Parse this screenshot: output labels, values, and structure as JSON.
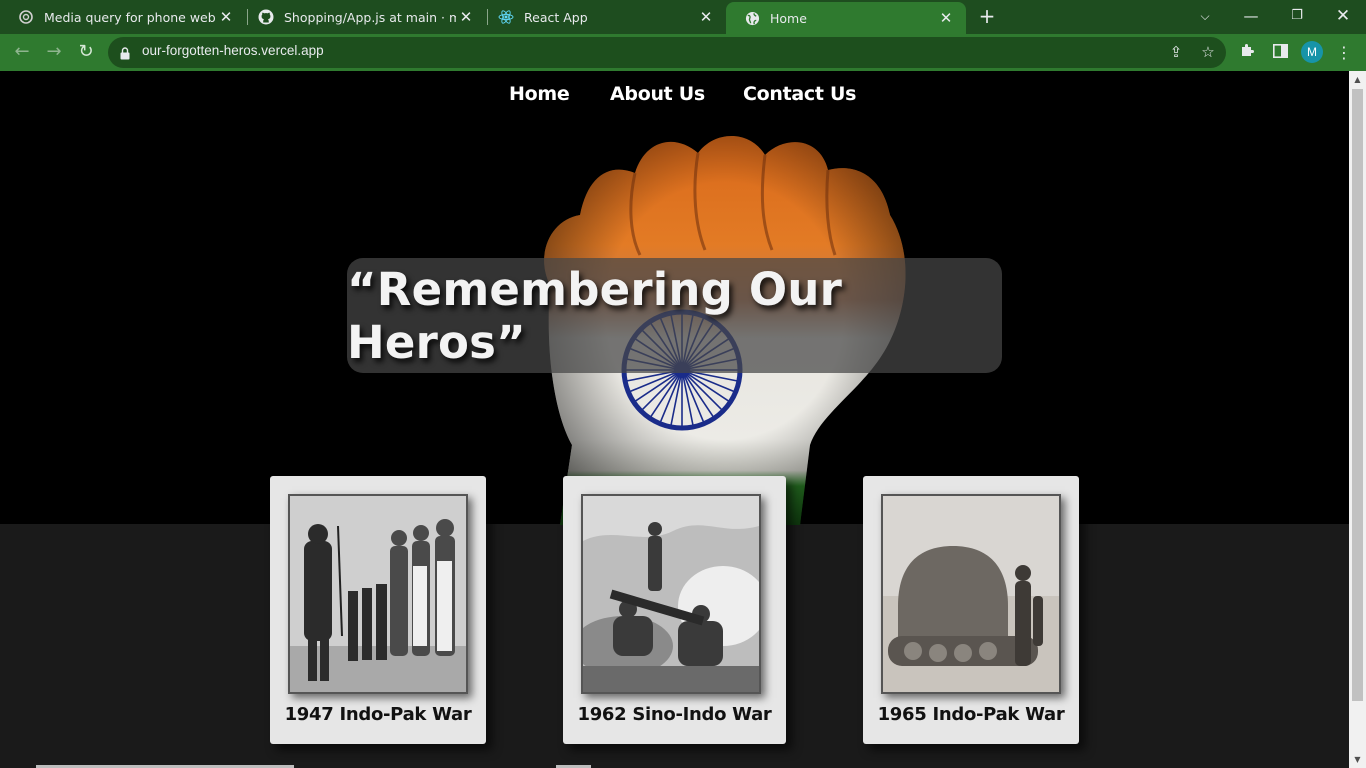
{
  "browser": {
    "tabs": [
      {
        "title": "Media query for phone website.",
        "icon": "chatgpt-icon",
        "active": false
      },
      {
        "title": "Shopping/App.js at main · mkgupta",
        "icon": "github-icon",
        "active": false
      },
      {
        "title": "React App",
        "icon": "react-icon",
        "active": false
      },
      {
        "title": "Home",
        "icon": "globe-icon",
        "active": true
      }
    ],
    "url": "our-forgotten-heros.vercel.app",
    "profile_initial": "M",
    "colors": {
      "frame": "#1e4d1f",
      "toolbar": "#2f7a2f",
      "avatar": "#1794a8"
    }
  },
  "page": {
    "nav": {
      "home": "Home",
      "about": "About Us",
      "contact": "Contact Us"
    },
    "hero": {
      "quote": "“Remembering Our Heros”"
    },
    "cards": [
      {
        "title": "1947 Indo-Pak War"
      },
      {
        "title": "1962 Sino-Indo War"
      },
      {
        "title": "1965 Indo-Pak War"
      }
    ]
  }
}
